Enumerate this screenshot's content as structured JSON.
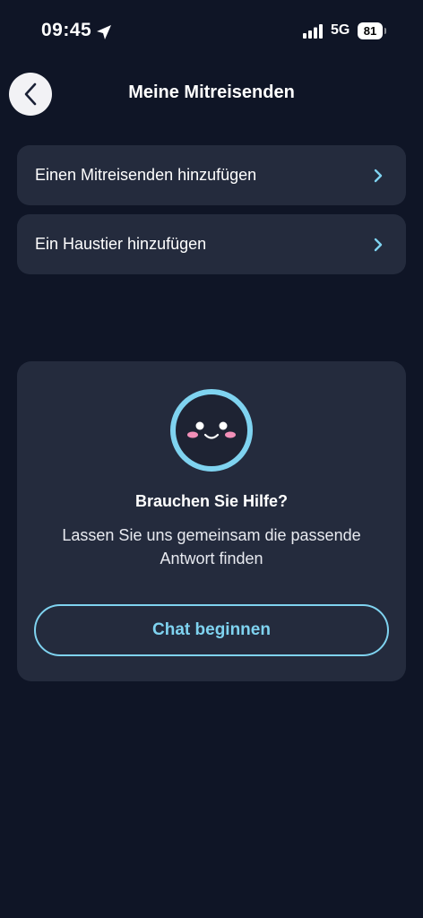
{
  "status_bar": {
    "time": "09:45",
    "network": "5G",
    "battery": "81"
  },
  "header": {
    "title": "Meine Mitreisenden",
    "back_icon": "chevron-left-icon"
  },
  "list": {
    "items": [
      {
        "label": "Einen Mitreisenden hinzufügen",
        "icon": "chevron-right-icon"
      },
      {
        "label": "Ein Haustier hinzufügen",
        "icon": "chevron-right-icon"
      }
    ]
  },
  "help_card": {
    "mascot_icon": "smiley-mascot-icon",
    "title": "Brauchen Sie Hilfe?",
    "text": "Lassen Sie uns gemeinsam die passende Antwort finden",
    "button_label": "Chat beginnen"
  },
  "colors": {
    "background": "#0f1526",
    "card": "#242b3d",
    "accent": "#7fd3f0"
  }
}
